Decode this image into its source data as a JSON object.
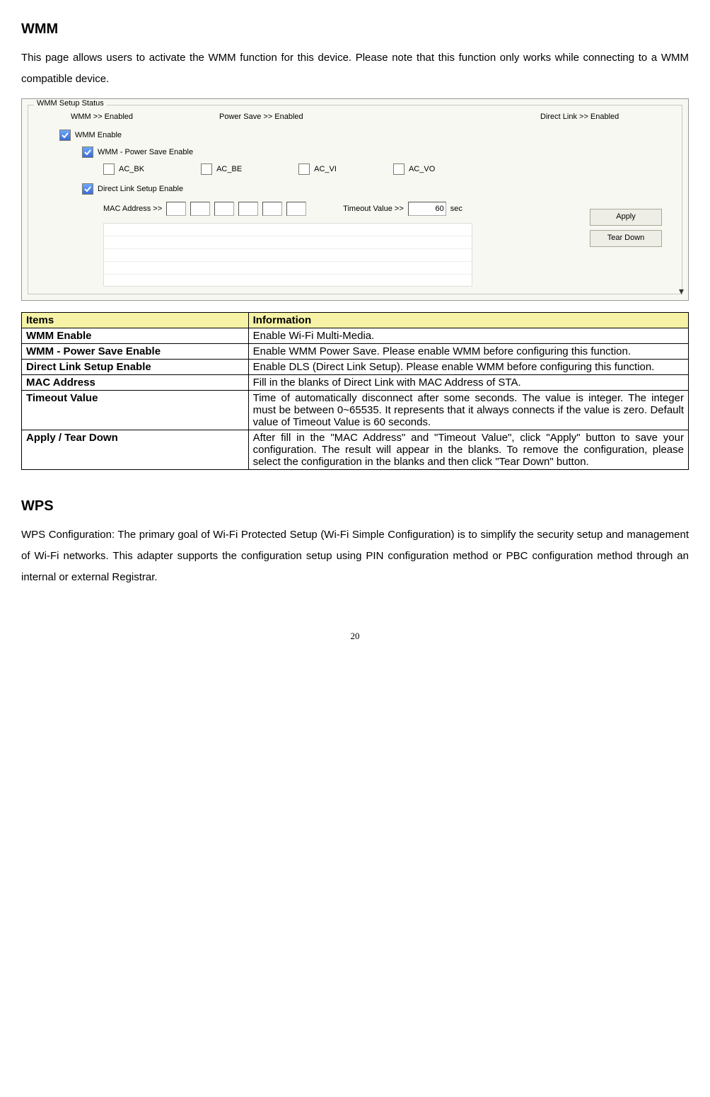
{
  "section1": {
    "title": "WMM",
    "intro": "This page allows users to activate the WMM function for this device. Please note that this function only works while connecting to a WMM compatible device."
  },
  "wmm_panel": {
    "legend": "WMM Setup Status",
    "status": {
      "wmm": "WMM >> Enabled",
      "ps": "Power Save >> Enabled",
      "dl": "Direct Link >> Enabled"
    },
    "wmm_enable": "WMM Enable",
    "ps_enable": "WMM - Power Save Enable",
    "ac_bk": "AC_BK",
    "ac_be": "AC_BE",
    "ac_vi": "AC_VI",
    "ac_vo": "AC_VO",
    "dls_enable": "Direct Link Setup Enable",
    "mac_label": "MAC Address >>",
    "timeout_label": "Timeout Value >>",
    "timeout_value": "60",
    "timeout_unit": "sec",
    "apply_btn": "Apply",
    "tear_btn": "Tear Down"
  },
  "table": {
    "h1": "Items",
    "h2": "Information",
    "rows": [
      {
        "item": "WMM Enable",
        "info": "Enable Wi-Fi Multi-Media."
      },
      {
        "item": "WMM - Power Save Enable",
        "info": "Enable WMM Power Save. Please enable WMM before configuring this function."
      },
      {
        "item": "Direct Link Setup Enable",
        "info": "Enable DLS (Direct Link Setup). Please enable WMM before configuring this function."
      },
      {
        "item": "MAC Address",
        "info": "Fill in the blanks of Direct Link with MAC Address of STA."
      },
      {
        "item": "Timeout Value",
        "info": "Time of automatically disconnect after some seconds. The value is integer. The integer must be between 0~65535. It represents that it always connects if the value is zero. Default value of Timeout Value is 60 seconds."
      },
      {
        "item": "Apply / Tear Down",
        "info": "After fill in the \"MAC Address\" and \"Timeout Value\", click \"Apply\" button to save your configuration. The result will appear in the blanks. To remove the configuration, please select the configuration in the blanks and then click \"Tear Down\" button."
      }
    ]
  },
  "section2": {
    "title": "WPS",
    "intro": "WPS Configuration: The primary goal of Wi-Fi Protected Setup (Wi-Fi Simple Configuration) is to simplify the security setup and management of Wi-Fi networks. This adapter supports the configuration setup using PIN configuration method or PBC configuration method through an internal or external Registrar."
  },
  "page_number": "20"
}
